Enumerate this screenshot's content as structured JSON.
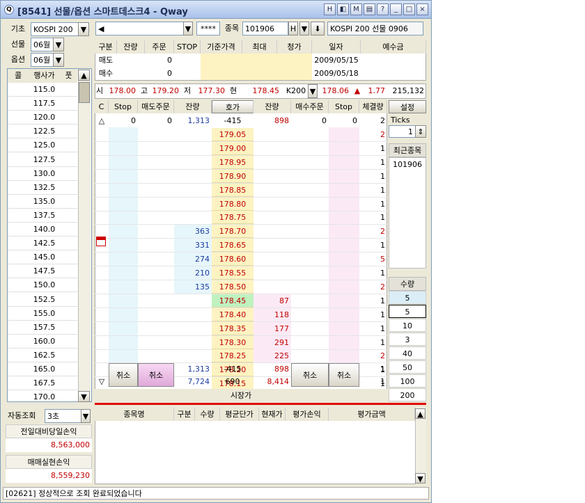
{
  "window": {
    "title": "[8541] 선물/옵션 스마트데스크4 - Qway",
    "buttons": [
      "H",
      "◧",
      "M",
      "▤",
      "?",
      "_",
      "□",
      "×"
    ]
  },
  "left": {
    "base_label": "기초",
    "base_value": "KOSPI 200",
    "fut_label": "선물",
    "fut_value": "06월",
    "opt_label": "옵션",
    "opt_value": "06월",
    "col_call": "콜",
    "col_strike": "행사가",
    "col_put": "풋",
    "strikes": [
      "115.0",
      "117.5",
      "120.0",
      "122.5",
      "125.0",
      "127.5",
      "130.0",
      "132.5",
      "135.0",
      "137.5",
      "140.0",
      "142.5",
      "145.0",
      "147.5",
      "150.0",
      "152.5",
      "155.0",
      "157.5",
      "160.0",
      "162.5",
      "165.0",
      "167.5",
      "170.0"
    ],
    "auto_label": "자동조회",
    "auto_value": "3초",
    "daily_pl_label": "전일대비당일손익",
    "daily_pl_value": "8,563,000",
    "realized_label": "매매실현손익",
    "realized_value": "8,559,230"
  },
  "top": {
    "masked": "****",
    "code_label": "종목",
    "code_value": "101906",
    "h_label": "H",
    "name": "KOSPI 200 선물 0906"
  },
  "info": {
    "headers": [
      "구분",
      "잔량",
      "주문",
      "STOP",
      "기준가격",
      "최대",
      "청가",
      "일자",
      "예수금"
    ],
    "rows": [
      {
        "type": "매도",
        "qty": "",
        "order": "0",
        "date": "2009/05/15"
      },
      {
        "type": "매수",
        "qty": "",
        "order": "0",
        "date": "2009/05/18"
      }
    ]
  },
  "quote": {
    "open_l": "시",
    "open": "178.00",
    "high_l": "고",
    "high": "179.20",
    "low_l": "저",
    "low": "177.30",
    "cur_l": "현",
    "cur": "178.45",
    "k200": "K200",
    "k200_val": "178.06",
    "chg_sym": "▲",
    "chg": "1.77",
    "vol": "215,132"
  },
  "ladder": {
    "headers": [
      "C",
      "Stop",
      "매도주문",
      "잔량",
      "호가",
      "잔량",
      "매수주문",
      "Stop",
      "체결량"
    ],
    "top_row": {
      "sym": "△",
      "sell_stop": "0",
      "sell_order": "0",
      "sell_rem": "1,313",
      "price": "-415",
      "buy_rem": "898",
      "buy_order": "0",
      "buy_stop": "0",
      "fill": "2"
    },
    "rows": [
      {
        "price": "179.05",
        "sell": "",
        "buy": "",
        "fill": "2"
      },
      {
        "price": "179.00",
        "sell": "",
        "buy": "",
        "fill": "1"
      },
      {
        "price": "178.95",
        "sell": "",
        "buy": "",
        "fill": "1"
      },
      {
        "price": "178.90",
        "sell": "",
        "buy": "",
        "fill": "1"
      },
      {
        "price": "178.85",
        "sell": "",
        "buy": "",
        "fill": "1"
      },
      {
        "price": "178.80",
        "sell": "",
        "buy": "",
        "fill": "1"
      },
      {
        "price": "178.75",
        "sell": "",
        "buy": "",
        "fill": "1"
      },
      {
        "price": "178.70",
        "sell": "363",
        "buy": "",
        "fill": "2"
      },
      {
        "price": "178.65",
        "sell": "331",
        "buy": "",
        "fill": "1"
      },
      {
        "price": "178.60",
        "sell": "274",
        "buy": "",
        "fill": "5"
      },
      {
        "price": "178.55",
        "sell": "210",
        "buy": "",
        "fill": "1"
      },
      {
        "price": "178.50",
        "sell": "135",
        "buy": "",
        "fill": "2"
      },
      {
        "price": "178.45",
        "sell": "",
        "buy": "87",
        "fill": "1"
      },
      {
        "price": "178.40",
        "sell": "",
        "buy": "118",
        "fill": "1"
      },
      {
        "price": "178.35",
        "sell": "",
        "buy": "177",
        "fill": "1"
      },
      {
        "price": "178.30",
        "sell": "",
        "buy": "291",
        "fill": "1"
      },
      {
        "price": "178.25",
        "sell": "",
        "buy": "225",
        "fill": "2"
      },
      {
        "price": "178.20",
        "sell": "",
        "buy": "",
        "fill": "1"
      },
      {
        "price": "178.15",
        "sell": "",
        "buy": "",
        "fill": "1"
      }
    ],
    "cancel": "취소",
    "bottom1": {
      "sell_rem": "1,313",
      "price": "-415",
      "buy_rem": "898",
      "fill": "1"
    },
    "bottom2": {
      "sym": "▽",
      "sell_rem": "7,724",
      "price": "690",
      "buy_rem": "8,414",
      "fill": "1"
    },
    "market": "시장가"
  },
  "side": {
    "settings": "설정",
    "ticks_label": "Ticks",
    "ticks_value": "1",
    "recent_label": "최근종목",
    "recent": [
      "101906"
    ],
    "qty_label": "수량",
    "qty": [
      "5",
      "5",
      "10",
      "3",
      "40",
      "50",
      "100",
      "200"
    ]
  },
  "positions": {
    "headers": [
      "종목명",
      "구분",
      "수량",
      "평균단가",
      "현재가",
      "평가손익",
      "평가금액"
    ]
  },
  "status": "[02621] 정상적으로 조회 완료되었습니다",
  "colors": {
    "ask_bg": "#fdf3c2",
    "cur_bg": "#bff2bf",
    "sell_bg": "#e6f6fb",
    "buy_bg": "#fbeaf6",
    "red_line": "#e00000"
  }
}
